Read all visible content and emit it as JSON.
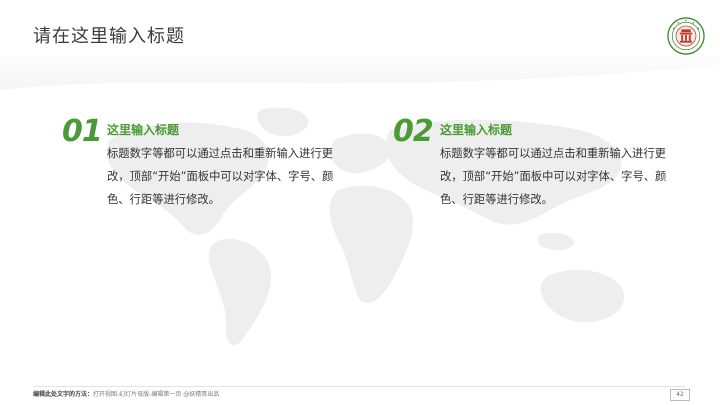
{
  "slide": {
    "title": "请在这里输入标题",
    "accent_color": "#4a9b35"
  },
  "logo": {
    "icon": "university-seal-icon"
  },
  "items": [
    {
      "number": "01",
      "heading": "这里输入标题",
      "body": "标题数字等都可以通过点击和重新输入进行更改，顶部“开始”面板中可以对字体、字号、颜色、行距等进行修改。"
    },
    {
      "number": "02",
      "heading": "这里输入标题",
      "body": "标题数字等都可以通过点击和重新输入进行更改，顶部“开始”面板中可以对字体、字号、颜色、行距等进行修改。"
    }
  ],
  "footer": {
    "label": "编辑此处文字的方法：",
    "instructions": "打开视图-幻灯片母版-编辑第一页 @妖精哥出品",
    "page_number": "42"
  }
}
